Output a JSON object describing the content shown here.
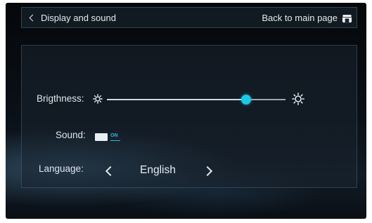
{
  "header": {
    "back_label": "Display and sound",
    "main_label": "Back to main page"
  },
  "settings": {
    "brightness": {
      "label": "Brigthness:",
      "level": 0.78
    },
    "sound": {
      "label": "Sound:",
      "state": "ON"
    },
    "language": {
      "label": "Language:",
      "value": "English"
    }
  },
  "colors": {
    "accent": "#1cc8e8",
    "toggle_text": "#2fb8e6"
  },
  "icons": {
    "back": "chevron-left-icon",
    "home": "home-icon",
    "brightness_low": "sun-small-icon",
    "brightness_high": "sun-large-icon",
    "language_prev": "chevron-left-icon",
    "language_next": "chevron-right-icon"
  }
}
